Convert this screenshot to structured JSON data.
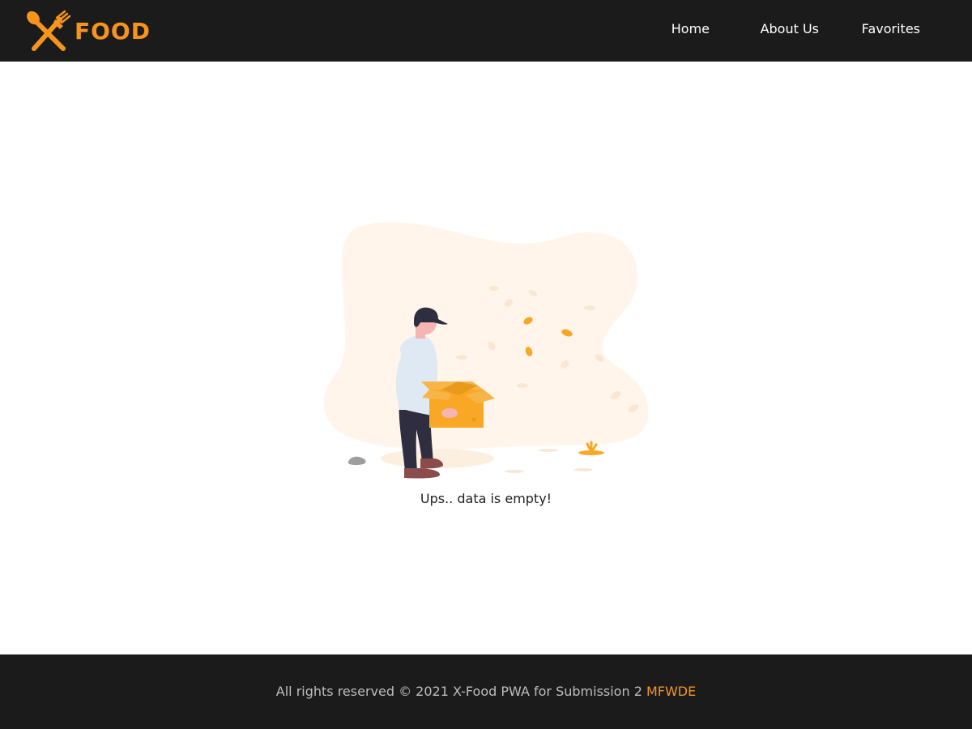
{
  "brand": {
    "name": "FOOD",
    "logo_icon": "crossed-spoon-fork-icon",
    "accent_color": "#f7941d"
  },
  "nav": {
    "items": [
      {
        "label": "Home"
      },
      {
        "label": "About Us"
      },
      {
        "label": "Favorites"
      }
    ]
  },
  "main": {
    "illustration": "empty-box-person-illustration",
    "empty_message": "Ups.. data is empty!"
  },
  "footer": {
    "text": "All rights reserved © 2021 X-Food PWA for Submission 2",
    "highlight": "MFWDE"
  },
  "colors": {
    "navbar_bg": "#1b1b1b",
    "footer_text": "#bdbdbd",
    "blob": "#fff5ea",
    "box": "#f9a826"
  }
}
